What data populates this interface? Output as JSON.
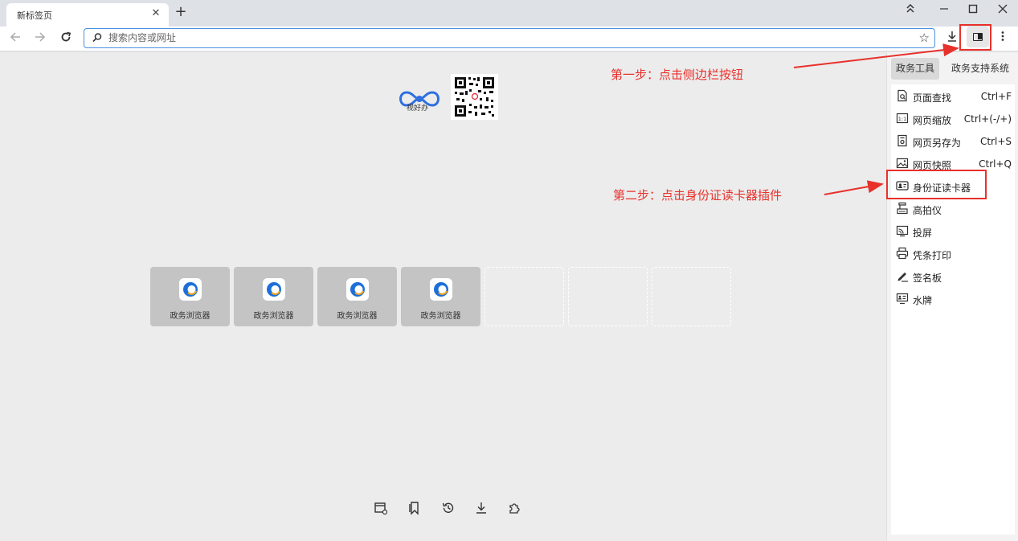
{
  "tabs": [
    {
      "title": "新标签页"
    }
  ],
  "window_controls": {
    "new_tab": "+",
    "close_tab": "✕"
  },
  "omnibox": {
    "placeholder": "搜索内容或网址",
    "value": ""
  },
  "newtab_page": {
    "logo_text": "视好办",
    "tiles": [
      {
        "label": "政务浏览器"
      },
      {
        "label": "政务浏览器"
      },
      {
        "label": "政务浏览器"
      },
      {
        "label": "政务浏览器"
      }
    ],
    "bottom_icons": [
      "window-settings-icon",
      "bookmarks-icon",
      "history-icon",
      "download-icon",
      "extensions-icon"
    ]
  },
  "sidebar": {
    "tabs": [
      {
        "label": "政务工具",
        "active": true
      },
      {
        "label": "政务支持系统",
        "active": false
      }
    ],
    "items": [
      {
        "label": "页面查找",
        "shortcut": "Ctrl+F",
        "icon": "find-page-icon"
      },
      {
        "label": "网页缩放",
        "shortcut": "Ctrl+(-/+)",
        "icon": "zoom-icon"
      },
      {
        "label": "网页另存为",
        "shortcut": "Ctrl+S",
        "icon": "save-page-icon"
      },
      {
        "label": "网页快照",
        "shortcut": "Ctrl+Q",
        "icon": "snapshot-icon"
      },
      {
        "label": "身份证读卡器",
        "shortcut": "",
        "icon": "id-card-icon"
      },
      {
        "label": "高拍仪",
        "shortcut": "",
        "icon": "scanner-icon"
      },
      {
        "label": "投屏",
        "shortcut": "",
        "icon": "cast-icon"
      },
      {
        "label": "凭条打印",
        "shortcut": "",
        "icon": "printer-icon"
      },
      {
        "label": "签名板",
        "shortcut": "",
        "icon": "signature-icon"
      },
      {
        "label": "水牌",
        "shortcut": "",
        "icon": "display-board-icon"
      }
    ]
  },
  "annotations": {
    "step1": "第一步：点击侧边栏按钮",
    "step2": "第二步：点击身份证读卡器插件",
    "color": "#e8312b"
  }
}
